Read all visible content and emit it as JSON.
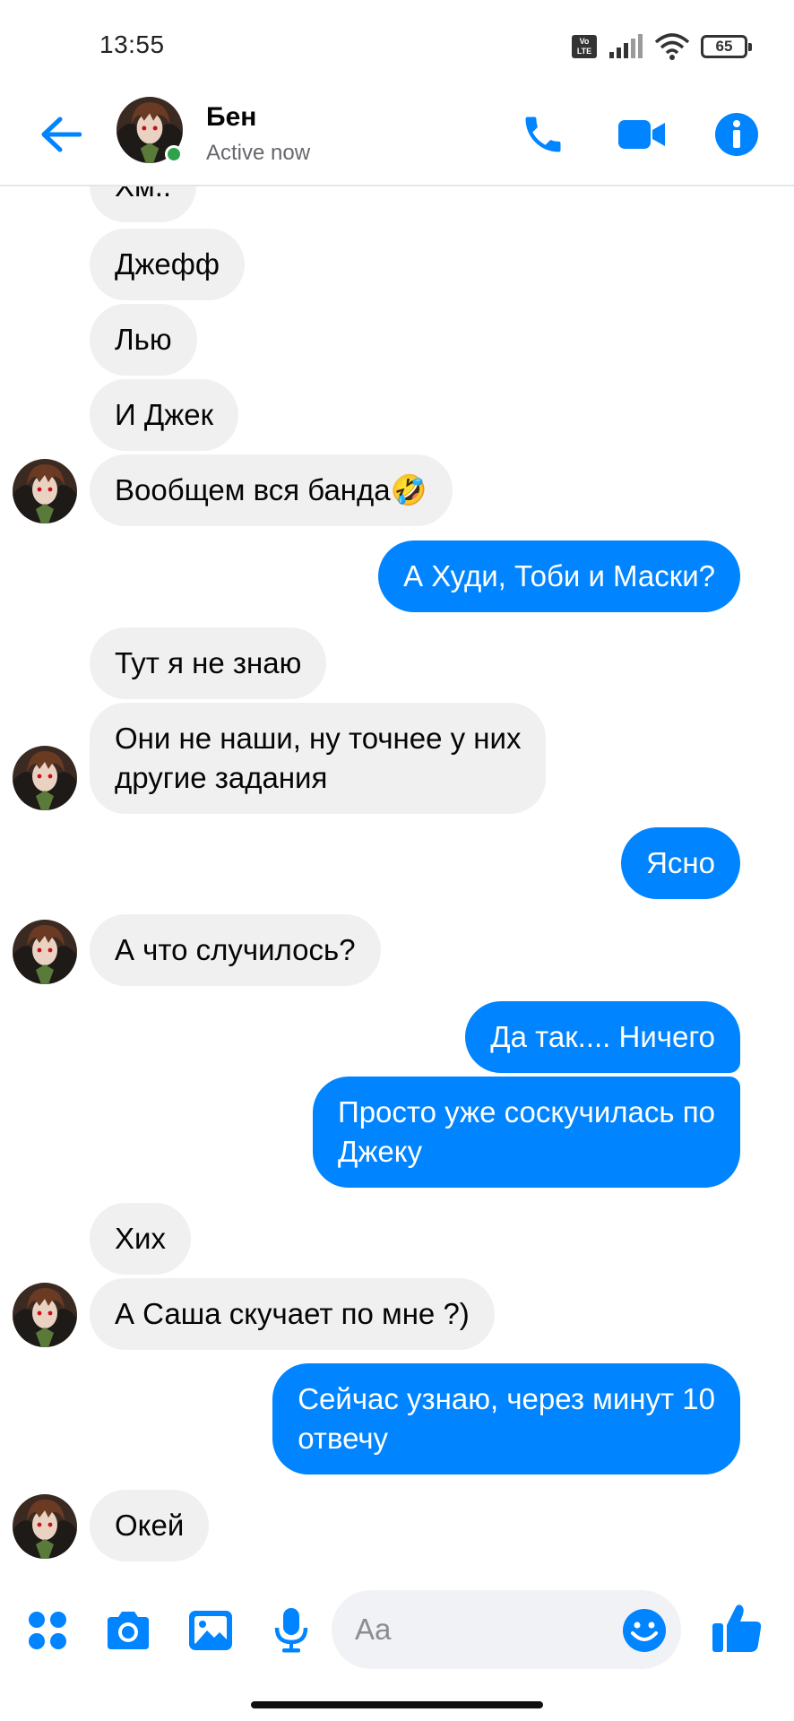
{
  "status_bar": {
    "time": "13:55",
    "volte": "Vo LTE",
    "battery": "65"
  },
  "header": {
    "name": "Бен",
    "status": "Active now"
  },
  "messages": [
    {
      "dir": "in",
      "text": "Хм.."
    },
    {
      "dir": "in",
      "text": "Джефф"
    },
    {
      "dir": "in",
      "text": "Лью"
    },
    {
      "dir": "in",
      "text": "И Джек"
    },
    {
      "dir": "in",
      "text": "Вообщем вся банда🤣"
    },
    {
      "dir": "out",
      "text": "А Худи, Тоби и Маски?"
    },
    {
      "dir": "in",
      "text": "Тут я не знаю"
    },
    {
      "dir": "in",
      "line1": "Они не наши, ну точнее у них",
      "line2": "другие задания"
    },
    {
      "dir": "out",
      "text": "Ясно"
    },
    {
      "dir": "in",
      "text": "А что случилось?"
    },
    {
      "dir": "out",
      "text": "Да так.... Ничего"
    },
    {
      "dir": "out",
      "line1": "Просто уже соскучилась по",
      "line2": "Джеку"
    },
    {
      "dir": "in",
      "text": "Хих"
    },
    {
      "dir": "in",
      "text": "А Саша скучает по мне ?)"
    },
    {
      "dir": "out",
      "line1": "Сейчас узнаю, через минут 10",
      "line2": "отвечу"
    },
    {
      "dir": "in",
      "text": "Окей"
    }
  ],
  "composer": {
    "placeholder": "Aa"
  },
  "colors": {
    "accent": "#0084ff",
    "incoming_bubble": "#f0f0f0",
    "online": "#31a24c"
  }
}
